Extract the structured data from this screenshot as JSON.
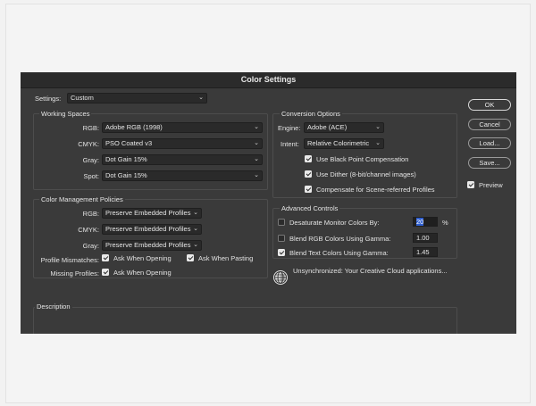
{
  "dialog": {
    "title": "Color Settings"
  },
  "settings": {
    "label": "Settings:",
    "value": "Custom"
  },
  "working_spaces": {
    "title": "Working Spaces",
    "rows": [
      {
        "label": "RGB:",
        "value": "Adobe RGB (1998)"
      },
      {
        "label": "CMYK:",
        "value": "PSO Coated v3"
      },
      {
        "label": "Gray:",
        "value": "Dot Gain 15%"
      },
      {
        "label": "Spot:",
        "value": "Dot Gain 15%"
      }
    ]
  },
  "policies": {
    "title": "Color Management Policies",
    "rows": [
      {
        "label": "RGB:",
        "value": "Preserve Embedded Profiles"
      },
      {
        "label": "CMYK:",
        "value": "Preserve Embedded Profiles"
      },
      {
        "label": "Gray:",
        "value": "Preserve Embedded Profiles"
      }
    ],
    "profile_mismatches": {
      "label": "Profile Mismatches:",
      "ask_opening": {
        "label": "Ask When Opening",
        "checked": true
      },
      "ask_pasting": {
        "label": "Ask When Pasting",
        "checked": true
      }
    },
    "missing_profiles": {
      "label": "Missing Profiles:",
      "ask_opening": {
        "label": "Ask When Opening",
        "checked": true
      }
    }
  },
  "conversion": {
    "title": "Conversion Options",
    "engine": {
      "label": "Engine:",
      "value": "Adobe (ACE)"
    },
    "intent": {
      "label": "Intent:",
      "value": "Relative Colorimetric"
    },
    "options": [
      {
        "label": "Use Black Point Compensation",
        "checked": true
      },
      {
        "label": "Use Dither (8-bit/channel images)",
        "checked": true
      },
      {
        "label": "Compensate for Scene-referred Profiles",
        "checked": true
      }
    ]
  },
  "advanced": {
    "title": "Advanced Controls",
    "desaturate": {
      "label": "Desaturate Monitor Colors By:",
      "value": "20",
      "unit": "%",
      "checked": false
    },
    "blend_rgb": {
      "label": "Blend RGB Colors Using Gamma:",
      "value": "1.00",
      "checked": false
    },
    "blend_text": {
      "label": "Blend Text Colors Using Gamma:",
      "value": "1.45",
      "checked": true
    }
  },
  "sync": {
    "icon": "globe-icon",
    "text": "Unsynchronized: Your Creative Cloud applications..."
  },
  "description": {
    "title": "Description"
  },
  "buttons": {
    "ok": "OK",
    "cancel": "Cancel",
    "load": "Load...",
    "save": "Save..."
  },
  "preview": {
    "label": "Preview",
    "checked": true
  },
  "colors": {
    "dialog_bg": "#3a3a3a",
    "titlebar_bg": "#2b2b2b",
    "highlight": "#2f5fd0"
  }
}
